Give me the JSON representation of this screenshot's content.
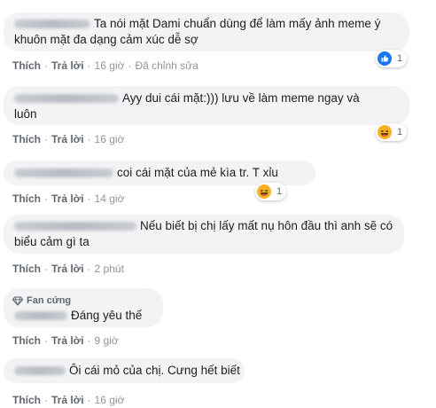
{
  "actions": {
    "like": "Thích",
    "reply": "Trả lời"
  },
  "comments": [
    {
      "text": "Ta nói mặt Dami chuẩn dùng để làm mấy ảnh meme ý khuôn mặt đa dạng cảm xúc dễ sợ",
      "time": "16 giờ",
      "edited": "Đã chỉnh sửa",
      "reaction_icon": "like-icon",
      "reaction_count": "1"
    },
    {
      "text": "Ayy dui cái mặt:))) lưu về làm meme ngay và luôn",
      "time": "16 giờ",
      "reaction_icon": "haha-icon",
      "reaction_count": "1"
    },
    {
      "text": "coi cái mặt của mẻ kìa tr. T xỉu",
      "time": "14 giờ",
      "reaction_icon": "haha-icon",
      "reaction_count": "1"
    },
    {
      "text": "Nếu biết bị chị lấy mất nụ hôn đầu thì anh sẽ có biểu cảm gì ta",
      "time": "2 phút"
    },
    {
      "badge": "Fan cứng",
      "badge_icon": "diamond-icon",
      "text": "Đáng yêu thế",
      "time": "9 giờ"
    },
    {
      "text": "Ôi cái mỏ của chị. Cưng hết biết",
      "time": "16 giờ"
    }
  ],
  "colors": {
    "like_blue": "#1877f2",
    "haha_yellow": "#f7b125",
    "meta_gray": "#606770"
  }
}
